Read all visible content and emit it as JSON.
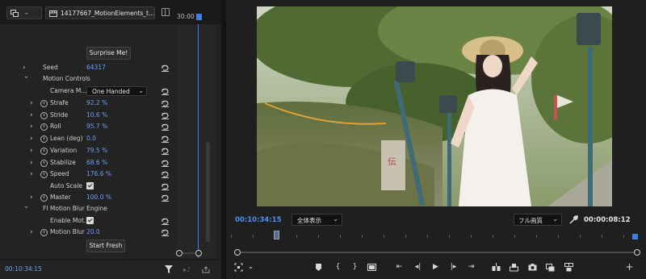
{
  "tabs": {
    "sequence_label": "–",
    "clip_label": "14177667_MotionElements_t..."
  },
  "ruler": {
    "time_label": "30:00"
  },
  "effect_controls": {
    "surprise_button": "Surprise Me!",
    "seed": {
      "label": "Seed",
      "value": "64317"
    },
    "motion_controls": {
      "label": "Motion Controls"
    },
    "camera_mode": {
      "label": "Camera M...",
      "value": "One Handed"
    },
    "strafe": {
      "label": "Strafe",
      "value": "92.2 %"
    },
    "stride": {
      "label": "Stride",
      "value": "10.6 %"
    },
    "roll": {
      "label": "Roll",
      "value": "95.7 %"
    },
    "lean": {
      "label": "Lean (deg)",
      "value": "0.0"
    },
    "variation": {
      "label": "Variation",
      "value": "79.5 %"
    },
    "stabilize": {
      "label": "Stabilize",
      "value": "68.6 %"
    },
    "speed": {
      "label": "Speed",
      "value": "176.6 %"
    },
    "auto_scale": {
      "label": "Auto Scale",
      "checked": true
    },
    "master": {
      "label": "Master",
      "value": "100.0 %"
    },
    "motion_blur_engine": {
      "label": "FI Motion Blur Engine"
    },
    "enable_motion": {
      "label": "Enable Mot...",
      "checked": true
    },
    "motion_blur": {
      "label": "Motion Blur",
      "value": "20.0"
    },
    "start_fresh_button": "Start Fresh"
  },
  "left_footer": {
    "timecode": "00:10:34:15"
  },
  "monitor": {
    "current_time": "00:10:34:15",
    "zoom_value": "全体表示",
    "quality_value": "フル画質",
    "duration": "00:00:08:12"
  },
  "colors": {
    "accent_blue": "#4e8ff0",
    "value_blue": "#6aa2f4",
    "panel_bg": "#232323"
  }
}
